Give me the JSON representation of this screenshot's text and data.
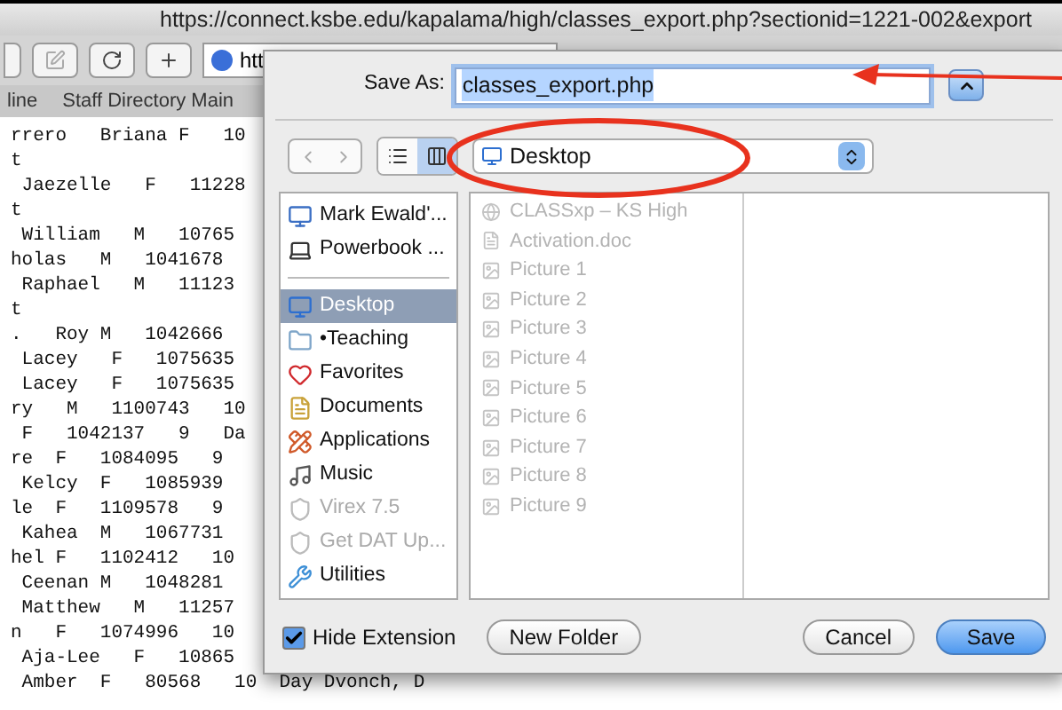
{
  "browser": {
    "title_url": "https://connect.ksbe.edu/kapalama/high/classes_export.php?sectionid=1221-002&export",
    "address": "htt",
    "bookmarks": [
      "line",
      "Staff Directory Main"
    ],
    "page_lines": [
      "rrero   Briana F   10",
      "t",
      " Jaezelle   F   11228",
      "t",
      " William   M   10765",
      "holas   M   1041678",
      " Raphael   M   11123",
      "t",
      ".   Roy M   1042666",
      " Lacey   F   1075635",
      " Lacey   F   1075635",
      "ry   M   1100743   10",
      " F   1042137   9   Da",
      "re  F   1084095   9",
      " Kelcy  F   1085939",
      "le  F   1109578   9",
      " Kahea  M   1067731",
      "hel F   1102412   10",
      " Ceenan M   1048281",
      " Matthew   M   11257",
      "n   F   1074996   10",
      " Aja-Lee   F   10865",
      " Amber  F   80568   10  Day Dvonch, D"
    ]
  },
  "save_dialog": {
    "save_as_label": "Save As:",
    "filename": "classes_export.php",
    "location": "Desktop",
    "view_buttons": [
      {
        "kind": "list",
        "selected": false
      },
      {
        "kind": "column",
        "selected": true
      }
    ],
    "sidebar": [
      {
        "label": "Mark Ewald'...",
        "kind": "computer",
        "selected": false,
        "disabled": false
      },
      {
        "label": "Powerbook ...",
        "kind": "laptop",
        "selected": false,
        "disabled": false
      },
      {
        "label": "Desktop",
        "kind": "desktop",
        "selected": true,
        "disabled": false
      },
      {
        "label": "•Teaching",
        "kind": "folder",
        "selected": false,
        "disabled": false
      },
      {
        "label": "Favorites",
        "kind": "heart",
        "selected": false,
        "disabled": false
      },
      {
        "label": "Documents",
        "kind": "documents",
        "selected": false,
        "disabled": false
      },
      {
        "label": "Applications",
        "kind": "applications",
        "selected": false,
        "disabled": false
      },
      {
        "label": "Music",
        "kind": "music",
        "selected": false,
        "disabled": false
      },
      {
        "label": "Virex 7.5",
        "kind": "shield",
        "selected": false,
        "disabled": true
      },
      {
        "label": "Get DAT Up...",
        "kind": "shield",
        "selected": false,
        "disabled": true
      },
      {
        "label": "Utilities",
        "kind": "utilities",
        "selected": false,
        "disabled": false
      }
    ],
    "files": [
      {
        "name": "CLASSxp – KS High",
        "kind": "app",
        "disabled": true
      },
      {
        "name": "Activation.doc",
        "kind": "doc",
        "disabled": true
      },
      {
        "name": "Picture 1",
        "kind": "picture",
        "disabled": true
      },
      {
        "name": "Picture 2",
        "kind": "picture",
        "disabled": true
      },
      {
        "name": "Picture 3",
        "kind": "picture",
        "disabled": true
      },
      {
        "name": "Picture 4",
        "kind": "picture",
        "disabled": true
      },
      {
        "name": "Picture 5",
        "kind": "picture",
        "disabled": true
      },
      {
        "name": "Picture 6",
        "kind": "picture",
        "disabled": true
      },
      {
        "name": "Picture 7",
        "kind": "picture",
        "disabled": true
      },
      {
        "name": "Picture 8",
        "kind": "picture",
        "disabled": true
      },
      {
        "name": "Picture 9",
        "kind": "picture",
        "disabled": true
      }
    ],
    "hide_extension": {
      "label": "Hide Extension",
      "checked": true
    },
    "buttons": [
      {
        "label": "New Folder",
        "kind": "secondary"
      },
      {
        "label": "Cancel",
        "kind": "secondary"
      },
      {
        "label": "Save",
        "kind": "default"
      }
    ]
  }
}
